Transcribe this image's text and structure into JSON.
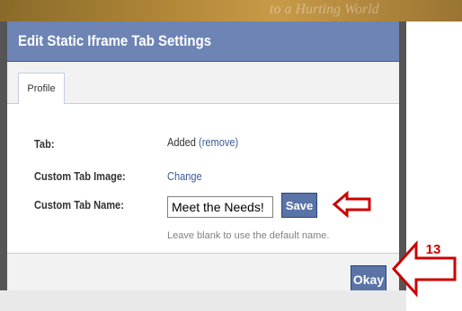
{
  "background": {
    "watermark_text": "to a Hurting World"
  },
  "dialog": {
    "title": "Edit Static Iframe Tab Settings",
    "tabs": [
      {
        "label": "Profile",
        "active": true
      }
    ],
    "rows": [
      {
        "label": "Tab:",
        "value": "Added",
        "link": "(remove)"
      },
      {
        "label": "Custom Tab Image:",
        "link": "Change"
      },
      {
        "label": "Custom Tab Name:"
      }
    ],
    "custom_tab_name": {
      "value": "Meet the Needs!",
      "save_label": "Save",
      "hint": "Leave blank to use the default name."
    },
    "footer": {
      "okay_label": "Okay"
    }
  },
  "annotations": {
    "step_number": "13",
    "arrow_color": "#cc0000"
  },
  "colors": {
    "titlebar": "#6d84b4",
    "button": "#5b74a8",
    "link": "#3b5998"
  }
}
